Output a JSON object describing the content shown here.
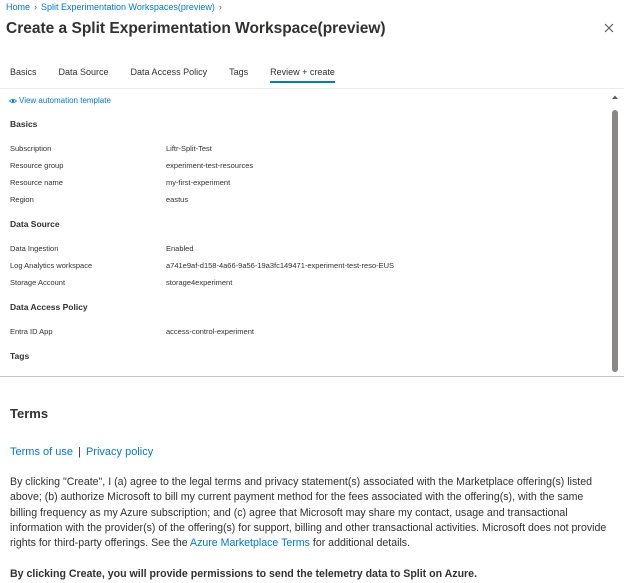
{
  "breadcrumb": {
    "home": "Home",
    "parent": "Split Experimentation Workspaces(preview)"
  },
  "page": {
    "title": "Create a Split Experimentation Workspace(preview)",
    "more": "···"
  },
  "tabs": [
    {
      "label": "Basics"
    },
    {
      "label": "Data Source"
    },
    {
      "label": "Data Access Policy"
    },
    {
      "label": "Tags"
    },
    {
      "label": "Review + create"
    }
  ],
  "active_tab": "Review + create",
  "automation_link": "View automation template",
  "review": {
    "basics": {
      "heading": "Basics",
      "rows": [
        {
          "label": "Subscription",
          "value": "Liftr-Split-Test"
        },
        {
          "label": "Resource group",
          "value": "experiment-test-resources"
        },
        {
          "label": "Resource name",
          "value": "my-first-experiment"
        },
        {
          "label": "Region",
          "value": "eastus"
        }
      ]
    },
    "data_source": {
      "heading": "Data Source",
      "rows": [
        {
          "label": "Data Ingestion",
          "value": "Enabled"
        },
        {
          "label": "Log Analytics workspace",
          "value": "a741e9af-d158-4a66-9a56-19a3fc149471-experiment-test-reso-EUS"
        },
        {
          "label": "Storage Account",
          "value": "storage4experiment"
        }
      ]
    },
    "data_access_policy": {
      "heading": "Data Access Policy",
      "rows": [
        {
          "label": "Entra ID App",
          "value": "access-control-experiment"
        }
      ]
    },
    "tags": {
      "heading": "Tags"
    }
  },
  "terms": {
    "title": "Terms",
    "terms_of_use": "Terms of use",
    "separator": "|",
    "privacy_policy": "Privacy policy",
    "body_before_link": "By clicking \"Create\", I (a) agree to the legal terms and privacy statement(s) associated with the Marketplace offering(s) listed above; (b) authorize Microsoft to bill my current payment method for the fees associated with the offering(s), with the same billing frequency as my Azure subscription; and (c) agree that Microsoft may share my contact, usage and transactional information with the provider(s) of the offering(s) for support, billing and other transactional activities. Microsoft does not provide rights for third-party offerings. See the",
    "marketplace_link": "Azure Marketplace Terms",
    "body_after_link": "for additional details.",
    "consent_notice": "By clicking Create, you will provide permissions to send the telemetry data to Split on Azure."
  },
  "colors": {
    "link": "#0078d4",
    "text": "#323130",
    "scroll_thumb": "#8a8886"
  }
}
